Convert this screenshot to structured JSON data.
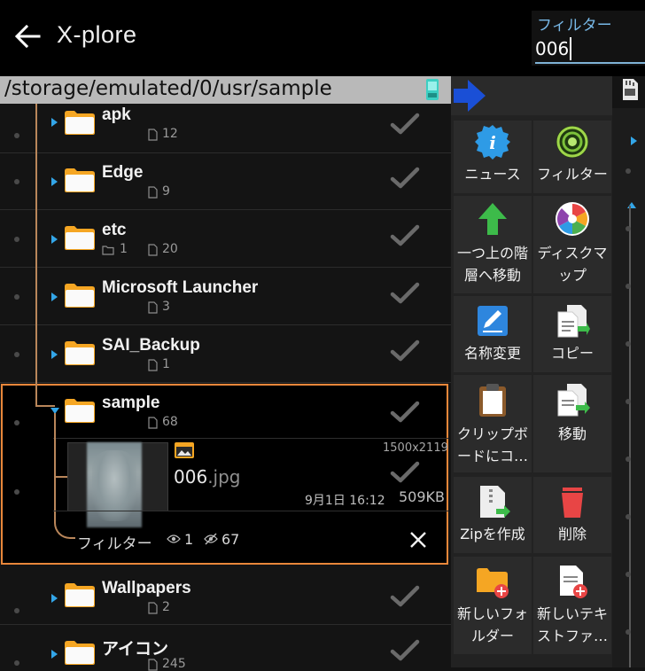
{
  "app": {
    "title": "X-plore"
  },
  "filter": {
    "label": "フィルター",
    "value": "006"
  },
  "path": "/storage/emulated/0/usr/sample",
  "folders": [
    {
      "name": "apk",
      "meta_files": "12"
    },
    {
      "name": "Edge",
      "meta_files": "9"
    },
    {
      "name": "etc",
      "meta_dirs": "1",
      "meta_files": "20"
    },
    {
      "name": "Microsoft Launcher",
      "meta_files": "3"
    },
    {
      "name": "SAI_Backup",
      "meta_files": "1"
    },
    {
      "name": "sample",
      "meta_files": "68"
    },
    {
      "name": "Wallpapers",
      "meta_files": "2"
    },
    {
      "name": "アイコン",
      "meta_files": "245"
    }
  ],
  "file": {
    "name_main": "006",
    "name_ext": ".jpg",
    "dimensions": "1500x2119",
    "date": "9月1日 16:12",
    "size": "509KB"
  },
  "filter_footer": {
    "label": "フィルター",
    "shown": "1",
    "hidden": "67"
  },
  "side_buttons": [
    {
      "label": "ニュース",
      "icon": "info-icon"
    },
    {
      "label": "フィルター",
      "icon": "filter-target-icon"
    },
    {
      "label": "一つ上の階層へ移動",
      "icon": "up-arrow-icon"
    },
    {
      "label": "ディスクマップ",
      "icon": "disk-map-icon"
    },
    {
      "label": "名称変更",
      "icon": "rename-icon"
    },
    {
      "label": "コピー",
      "icon": "copy-icon"
    },
    {
      "label": "クリップボードにコ…",
      "icon": "clipboard-icon"
    },
    {
      "label": "移動",
      "icon": "move-icon"
    },
    {
      "label": "Zipを作成",
      "icon": "zip-icon"
    },
    {
      "label": "削除",
      "icon": "trash-icon"
    },
    {
      "label": "新しいフォルダー",
      "icon": "new-folder-icon"
    },
    {
      "label": "新しいテキストファ…",
      "icon": "new-text-file-icon"
    }
  ],
  "colors": {
    "accent": "#33a6e8",
    "selection": "#e8873a",
    "folder": "#f5a623",
    "tree": "#b9865a"
  }
}
